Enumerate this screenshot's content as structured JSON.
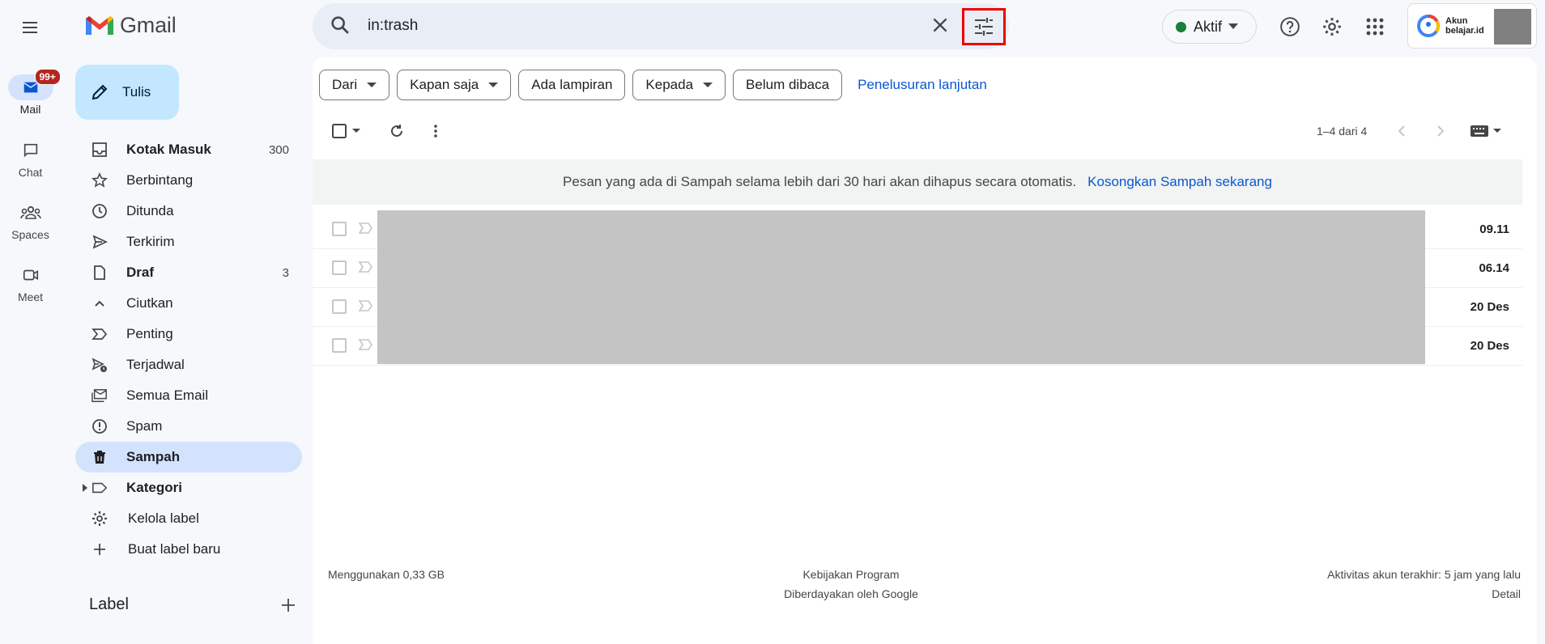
{
  "app": {
    "name": "Gmail"
  },
  "rail": {
    "items": [
      {
        "label": "Mail",
        "badge": "99+"
      },
      {
        "label": "Chat"
      },
      {
        "label": "Spaces"
      },
      {
        "label": "Meet"
      }
    ]
  },
  "compose": {
    "label": "Tulis"
  },
  "nav": {
    "items": [
      {
        "label": "Kotak Masuk",
        "count": "300"
      },
      {
        "label": "Berbintang"
      },
      {
        "label": "Ditunda"
      },
      {
        "label": "Terkirim"
      },
      {
        "label": "Draf",
        "count": "3"
      },
      {
        "label": "Ciutkan"
      },
      {
        "label": "Penting"
      },
      {
        "label": "Terjadwal"
      },
      {
        "label": "Semua Email"
      },
      {
        "label": "Spam"
      },
      {
        "label": "Sampah"
      },
      {
        "label": "Kategori"
      },
      {
        "label": "Kelola label"
      },
      {
        "label": "Buat label baru"
      }
    ],
    "label_heading": "Label"
  },
  "search": {
    "value": "in:trash"
  },
  "header": {
    "status": "Aktif",
    "account_line1": "Akun",
    "account_line2": "belajar.id"
  },
  "filters": {
    "chips": [
      {
        "label": "Dari"
      },
      {
        "label": "Kapan saja"
      },
      {
        "label": "Ada lampiran"
      },
      {
        "label": "Kepada"
      },
      {
        "label": "Belum dibaca"
      }
    ],
    "advanced": "Penelusuran lanjutan"
  },
  "toolbar": {
    "pagination": "1–4 dari 4"
  },
  "banner": {
    "text": "Pesan yang ada di Sampah selama lebih dari 30 hari akan dihapus secara otomatis.",
    "link": "Kosongkan Sampah sekarang"
  },
  "messages": [
    {
      "date": "09.11"
    },
    {
      "date": "06.14"
    },
    {
      "date": "20 Des"
    },
    {
      "date": "20 Des"
    }
  ],
  "footer": {
    "storage": "Menggunakan 0,33 GB",
    "policy": "Kebijakan Program",
    "powered": "Diberdayakan oleh Google",
    "activity": "Aktivitas akun terakhir: 5 jam yang lalu",
    "details": "Detail"
  }
}
